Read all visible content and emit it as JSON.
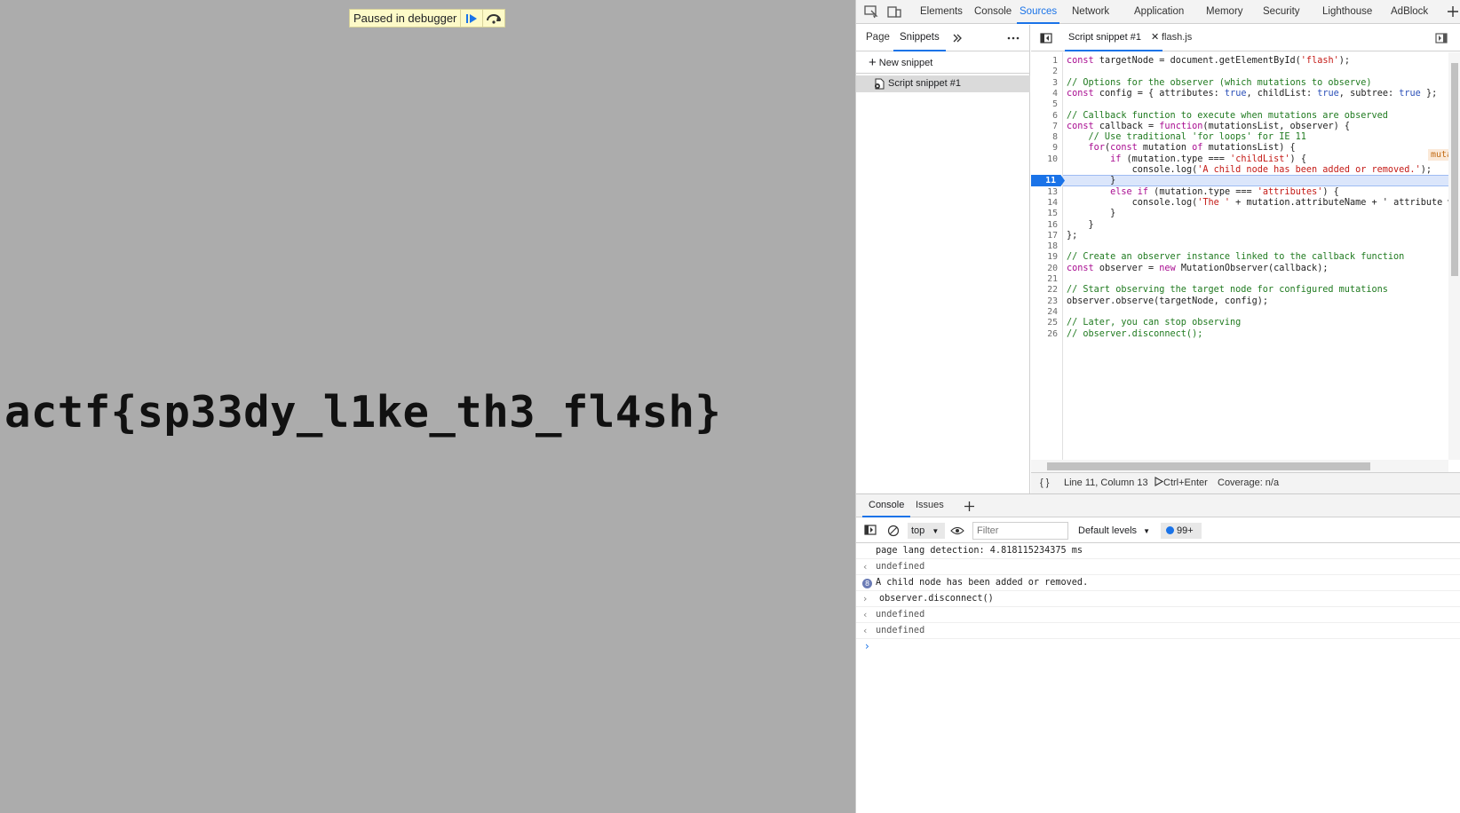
{
  "page": {
    "flag_text": "actf{sp33dy_l1ke_th3_fl4sh}",
    "paused_label": "Paused in debugger"
  },
  "devtools": {
    "main_tabs": [
      "Elements",
      "Console",
      "Sources",
      "Network",
      "Application",
      "Memory",
      "Security",
      "Lighthouse",
      "AdBlock"
    ],
    "active_main_tab": "Sources",
    "navigator": {
      "tabs": [
        "Page",
        "Snippets"
      ],
      "active_tab": "Snippets",
      "new_snippet_label": "New snippet",
      "snippet_item": "Script snippet #1"
    },
    "editor": {
      "tabs": [
        "Script snippet #1",
        "flash.js"
      ],
      "active_tab": "Script snippet #1",
      "current_line": "11",
      "inline_hint": "mutationsList = [MutationRec",
      "lines": [
        "const targetNode = document.getElementById('flash');",
        "",
        "// Options for the observer (which mutations to observe)",
        "const config = { attributes: true, childList: true, subtree: true };",
        "",
        "// Callback function to execute when mutations are observed",
        "const callback = function(mutationsList, observer) {",
        "    // Use traditional 'for loops' for IE 11",
        "    for(const mutation of mutationsList) {",
        "        if (mutation.type === 'childList') {",
        "            console.log('A child node has been added or removed.');",
        "        }",
        "        else if (mutation.type === 'attributes') {",
        "            console.log('The ' + mutation.attributeName + ' attribute was",
        "        }",
        "    }",
        "};",
        "",
        "// Create an observer instance linked to the callback function",
        "const observer = new MutationObserver(callback);",
        "",
        "// Start observing the target node for configured mutations",
        "observer.observe(targetNode, config);",
        "",
        "// Later, you can stop observing",
        "// observer.disconnect();"
      ]
    },
    "status_bar": {
      "format_label": "{ }",
      "position": "Line 11, Column 13",
      "run_shortcut": "Ctrl+Enter",
      "coverage": "Coverage: n/a"
    },
    "drawer": {
      "tabs": [
        "Console",
        "Issues"
      ],
      "active_tab": "Console",
      "context": "top",
      "filter_placeholder": "Filter",
      "levels": "Default levels",
      "issues_count": "99+",
      "messages": [
        {
          "prefix": "",
          "text": "page lang detection: 4.818115234375 ms",
          "kind": "log"
        },
        {
          "prefix": "‹",
          "text": "undefined",
          "kind": "result"
        },
        {
          "prefix": "",
          "text": "A child node has been added or removed.",
          "kind": "log",
          "count": "8"
        },
        {
          "prefix": "›",
          "text": "observer.disconnect()",
          "kind": "input"
        },
        {
          "prefix": "‹",
          "text": "undefined",
          "kind": "result"
        },
        {
          "prefix": "‹",
          "text": "undefined",
          "kind": "result"
        }
      ],
      "prompt": "›"
    }
  }
}
